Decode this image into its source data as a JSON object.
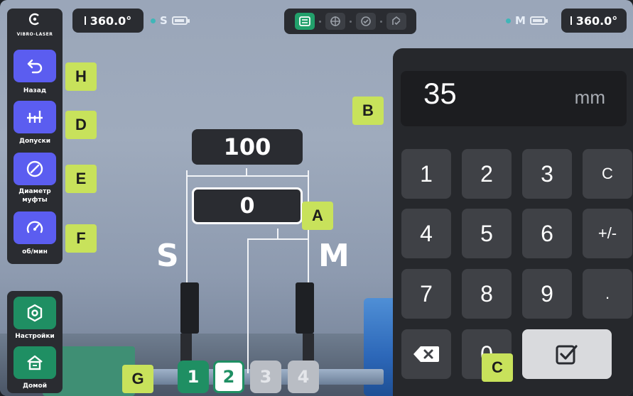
{
  "top_bar": {
    "left_angle": "360.0°",
    "left_side": "S",
    "right_side": "M",
    "right_angle": "360.0°",
    "modes": [
      "horizontal-shafts-icon",
      "crosshair-icon",
      "target-icon",
      "check-badge-icon"
    ]
  },
  "sidebar": {
    "logo_text": "VIBRO-LASER",
    "items": [
      {
        "label": "Назад",
        "icon": "back-arrow-icon"
      },
      {
        "label": "Допуски",
        "icon": "tolerance-sliders-icon"
      },
      {
        "label": "Диаметр муфты",
        "icon": "diameter-icon"
      },
      {
        "label": "об/мин",
        "icon": "rpm-gauge-icon"
      }
    ],
    "bottom_items": [
      {
        "label": "Настройки",
        "icon": "settings-icon"
      },
      {
        "label": "Домой",
        "icon": "home-icon"
      }
    ]
  },
  "diagram": {
    "distance_top": "100",
    "distance_input": "0",
    "left_label": "S",
    "right_label": "M"
  },
  "keypad": {
    "value": "35",
    "unit": "mm",
    "keys": [
      "1",
      "2",
      "3",
      "C",
      "4",
      "5",
      "6",
      "+/-",
      "7",
      "8",
      "9",
      ".",
      "0"
    ],
    "backspace_icon": "backspace-icon",
    "confirm_icon": "checkbox-confirm-icon"
  },
  "steps": [
    "1",
    "2",
    "3",
    "4"
  ],
  "current_step": 2,
  "callouts": {
    "A": "A",
    "B": "B",
    "C": "C",
    "D": "D",
    "E": "E",
    "F": "F",
    "G": "G",
    "H": "H"
  },
  "colors": {
    "accent_purple": "#5b5df0",
    "accent_green": "#1f8f63",
    "callout_yellow": "#c8e25b",
    "panel_dark": "#2a2c31"
  }
}
